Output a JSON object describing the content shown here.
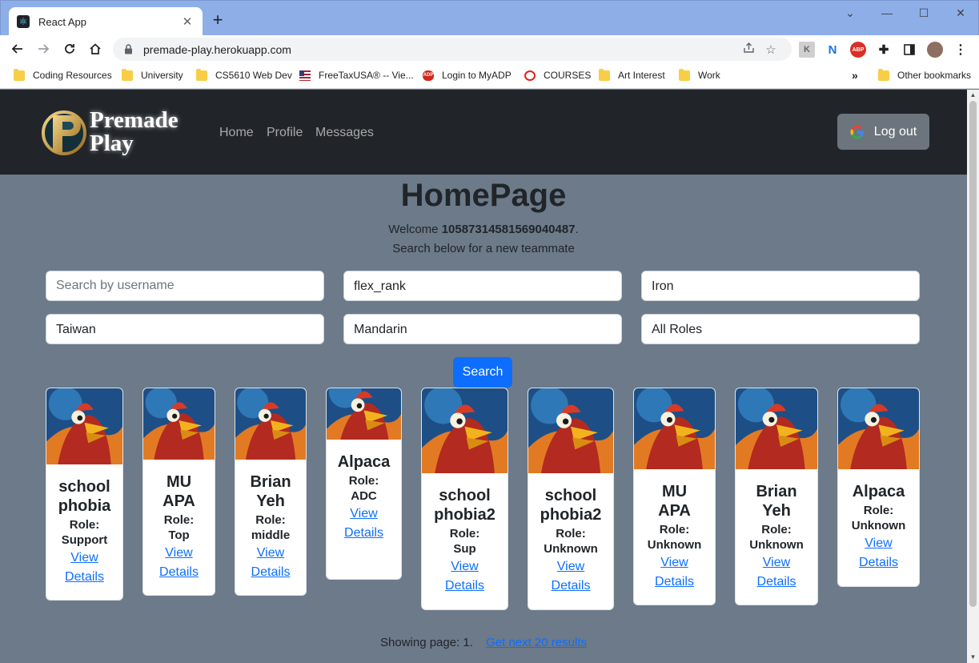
{
  "browser": {
    "tab_title": "React App",
    "url": "premade-play.herokuapp.com",
    "bookmarks": [
      {
        "label": "Coding Resources",
        "icon": "folder-icon"
      },
      {
        "label": "University",
        "icon": "folder-icon"
      },
      {
        "label": "CS5610 Web Dev",
        "icon": "folder-icon"
      },
      {
        "label": "FreeTaxUSA® -- Vie...",
        "icon": "us-flag-icon"
      },
      {
        "label": "Login to MyADP",
        "icon": "adp-icon"
      },
      {
        "label": "COURSES",
        "icon": "courses-icon"
      },
      {
        "label": "Art Interest",
        "icon": "folder-icon"
      },
      {
        "label": "Work",
        "icon": "folder-icon"
      }
    ],
    "overflow": "»",
    "other_bookmarks": "Other bookmarks",
    "extensions": {
      "abp": "ABP",
      "n": "N"
    }
  },
  "nav": {
    "logo_line1": "Premade",
    "logo_line2": "Play",
    "links": [
      "Home",
      "Profile",
      "Messages"
    ],
    "logout": "Log out"
  },
  "page": {
    "title": "HomePage",
    "welcome_prefix": "Welcome ",
    "user_id": "10587314581569040487",
    "welcome_suffix": ".",
    "subtitle": "Search below for a new teammate"
  },
  "search": {
    "username_placeholder": "Search by username",
    "queue": "flex_rank",
    "rank": "Iron",
    "region": "Taiwan",
    "language": "Mandarin",
    "role": "All Roles",
    "button": "Search"
  },
  "cards": [
    {
      "name_line1": "school",
      "name_line2": "phobia",
      "role_label": "Role:",
      "role": "Support",
      "link_line1": "View",
      "link_line2": "Details"
    },
    {
      "name_line1": "MU",
      "name_line2": "APA",
      "role_label": "Role:",
      "role": "Top",
      "link_line1": "View",
      "link_line2": "Details"
    },
    {
      "name_line1": "Brian",
      "name_line2": "Yeh",
      "role_label": "Role:",
      "role": "middle",
      "link_line1": "View",
      "link_line2": "Details"
    },
    {
      "name_line1": "Alpaca",
      "name_line2": "",
      "role_label": "Role:",
      "role": "ADC",
      "link_line1": "View",
      "link_line2": "Details"
    },
    {
      "name_line1": "school",
      "name_line2": "phobia2",
      "role_label": "Role:",
      "role": "Sup",
      "link_line1": "View",
      "link_line2": "Details"
    },
    {
      "name_line1": "school",
      "name_line2": "phobia2",
      "role_label": "Role:",
      "role": "Unknown",
      "link_line1": "View",
      "link_line2": "Details"
    },
    {
      "name_line1": "MU",
      "name_line2": "APA",
      "role_label": "Role:",
      "role": "Unknown",
      "link_line1": "View",
      "link_line2": "Details"
    },
    {
      "name_line1": "Brian",
      "name_line2": "Yeh",
      "role_label": "Role:",
      "role": "Unknown",
      "link_line1": "View",
      "link_line2": "Details"
    },
    {
      "name_line1": "Alpaca",
      "name_line2": "",
      "role_label": "Role:",
      "role": "Unknown",
      "link_line1": "View",
      "link_line2": "Details"
    }
  ],
  "pager": {
    "showing": "Showing page: 1.",
    "next": "Get next 20 results"
  },
  "colors": {
    "navbar": "#212529",
    "page_bg": "#6c7a89",
    "primary": "#0d6efd",
    "secondary": "#6c757d"
  }
}
